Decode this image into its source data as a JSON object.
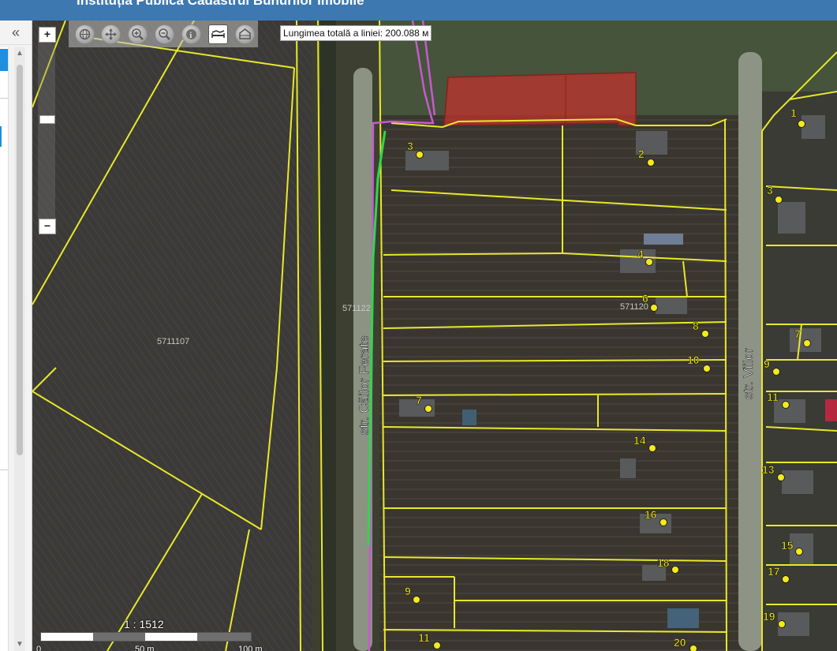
{
  "header": {
    "title": "Instituția Publică Cadastrul Bunurilor Imobile"
  },
  "sidebar": {
    "collapse_glyph": "«",
    "scroll_up": "▲",
    "scroll_down": "▼"
  },
  "zoom": {
    "in_label": "+",
    "out_label": "−"
  },
  "toolbar": {
    "tools": [
      "globe-icon",
      "pan-icon",
      "zoom-in-icon",
      "zoom-out-icon",
      "info-icon",
      "measure-line-icon",
      "measure-area-icon"
    ],
    "active_tool": "measure-line-icon"
  },
  "measure": {
    "label": "Lungimea totală a liniei: 200.088 м"
  },
  "map": {
    "parcel_ids": [
      "5711107",
      "571122",
      "571120"
    ],
    "street_names": [
      "str. Căilor Ferate",
      "str. Viilor"
    ],
    "house_numbers": [
      "1",
      "2",
      "3",
      "3",
      "4",
      "6",
      "8",
      "10",
      "7",
      "7",
      "9",
      "11",
      "13",
      "14",
      "15",
      "16",
      "17",
      "18",
      "19",
      "9",
      "11",
      "20"
    ],
    "colors": {
      "parcel_lines": "#e8e82a",
      "highlight_fill": "#c0312d",
      "measure_line": "#2ed84a",
      "railway_line": "#c65ad0",
      "point": "#f5ea1a"
    }
  },
  "scale": {
    "ratio": "1 : 1512",
    "ticks": [
      "0",
      "50 m",
      "100 m"
    ]
  }
}
